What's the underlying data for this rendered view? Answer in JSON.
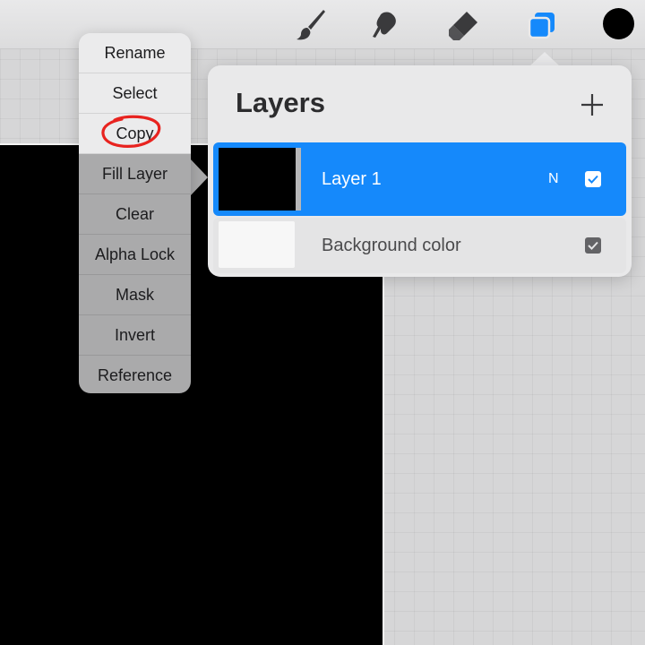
{
  "toolbar": {
    "tools": [
      "brush-icon",
      "smudge-icon",
      "eraser-icon",
      "layers-icon"
    ],
    "active_tool": "layers-icon",
    "accent_color": "#1589fb",
    "current_color": "#000000"
  },
  "layers_panel": {
    "title": "Layers",
    "layers": [
      {
        "name": "Layer 1",
        "blend_mode": "N",
        "visible": true,
        "selected": true
      },
      {
        "name": "Background color",
        "visible": true,
        "selected": false
      }
    ]
  },
  "context_menu": {
    "items": [
      "Rename",
      "Select",
      "Copy",
      "Fill Layer",
      "Clear",
      "Alpha Lock",
      "Mask",
      "Invert",
      "Reference"
    ],
    "annotated_item": "Copy",
    "annotation_color": "#e8231f"
  }
}
